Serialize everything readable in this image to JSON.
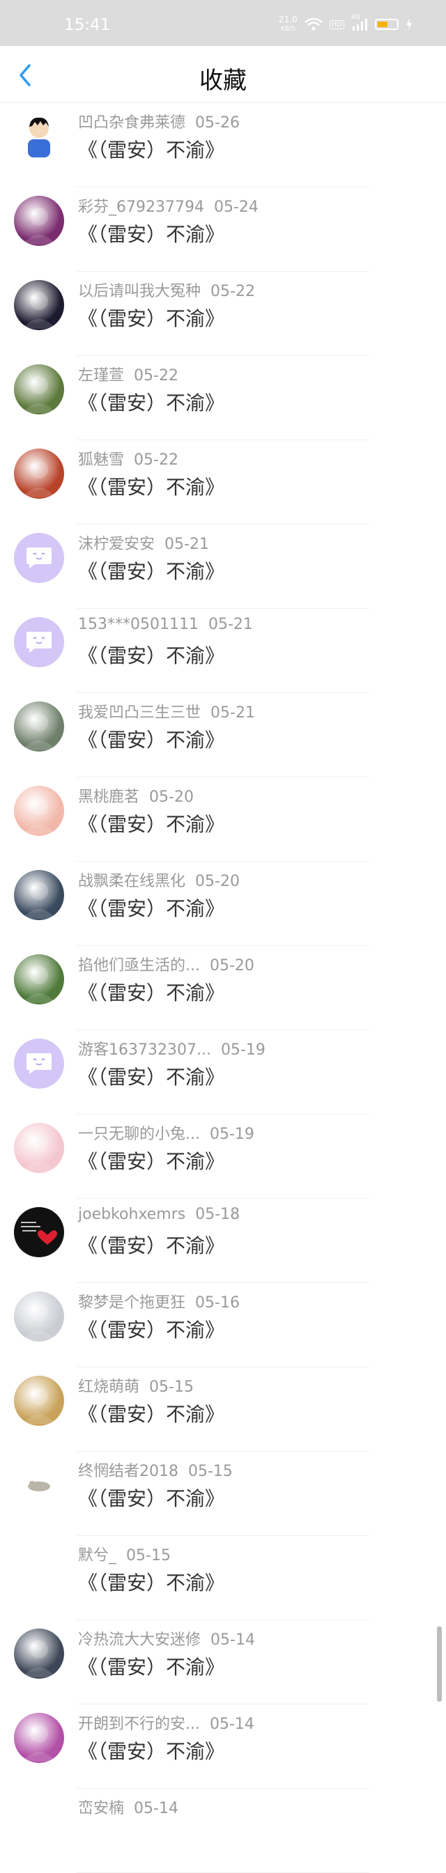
{
  "status_bar": {
    "time": "15:41",
    "net_speed_value": "21.0",
    "net_speed_unit": "KB/S",
    "hd_label": "HD",
    "network_label": "4G",
    "battery_level": 0.55,
    "battery_color": "#f5b300"
  },
  "header": {
    "title": "收藏"
  },
  "comments": [
    {
      "user": "凹凸杂食弗莱德",
      "date": "05-26",
      "text": "《（雷安）不渝》",
      "avatar": "cartoon-boy",
      "color": "#3a6fd8"
    },
    {
      "user": "彩芬_679237794",
      "date": "05-24",
      "text": "《（雷安）不渝》",
      "avatar": "photo",
      "color": "#7a2c6e"
    },
    {
      "user": "以后请叫我大冤种",
      "date": "05-22",
      "text": "《（雷安）不渝》",
      "avatar": "anime",
      "color": "#1c1a2e"
    },
    {
      "user": "左瑾萱",
      "date": "05-22",
      "text": "《（雷安）不渝》",
      "avatar": "photo",
      "color": "#5d7a3c"
    },
    {
      "user": "狐魅雪",
      "date": "05-22",
      "text": "《（雷安）不渝》",
      "avatar": "anime",
      "color": "#b8432a"
    },
    {
      "user": "沫柠爱安安",
      "date": "05-21",
      "text": "《（雷安）不渝》",
      "avatar": "default",
      "color": "#d4c6f7"
    },
    {
      "user": "153***0501111",
      "date": "05-21",
      "text": "《（雷安）不渝》",
      "avatar": "default",
      "color": "#d4c6f7"
    },
    {
      "user": "我爱凹凸三生三世",
      "date": "05-21",
      "text": "《（雷安）不渝》",
      "avatar": "anime",
      "color": "#6e7f6a"
    },
    {
      "user": "黑桃鹿茗",
      "date": "05-20",
      "text": "《（雷安）不渝》",
      "avatar": "anime",
      "color": "#f2b7a9"
    },
    {
      "user": "战飘柔在线黑化",
      "date": "05-20",
      "text": "《（雷安）不渝》",
      "avatar": "anime",
      "color": "#3a4a5e"
    },
    {
      "user": "掐他们亟生活的...",
      "date": "05-20",
      "text": "《（雷安）不渝》",
      "avatar": "photo",
      "color": "#4f7a3a"
    },
    {
      "user": "游客163732307...",
      "date": "05-19",
      "text": "《（雷安）不渝》",
      "avatar": "default",
      "color": "#d4c6f7"
    },
    {
      "user": "一只无聊的小兔...",
      "date": "05-19",
      "text": "《（雷安）不渝》",
      "avatar": "anime",
      "color": "#f4c6cf"
    },
    {
      "user": "joebkohxemrs",
      "date": "05-18",
      "text": "《（雷安）不渝》",
      "avatar": "heart",
      "color": "#111111"
    },
    {
      "user": "黎梦是个拖更狂",
      "date": "05-16",
      "text": "《（雷安）不渝》",
      "avatar": "anime",
      "color": "#c9ccd3"
    },
    {
      "user": "红烧萌萌",
      "date": "05-15",
      "text": "《（雷安）不渝》",
      "avatar": "anime",
      "color": "#c9a25a"
    },
    {
      "user": "终惘结者2018",
      "date": "05-15",
      "text": "《（雷安）不渝》",
      "avatar": "small",
      "color": "#b9b5a8"
    },
    {
      "user": "默兮_",
      "date": "05-15",
      "text": "《（雷安）不渝》",
      "avatar": "none",
      "color": "#ffffff"
    },
    {
      "user": "冷热流大大安迷修",
      "date": "05-14",
      "text": "《（雷安）不渝》",
      "avatar": "anime",
      "color": "#3e4758"
    },
    {
      "user": "开朗到不行的安...",
      "date": "05-14",
      "text": "《（雷安）不渝》",
      "avatar": "anime",
      "color": "#b24fa6"
    },
    {
      "user": "峦安楠",
      "date": "05-14",
      "text": "",
      "avatar": "none",
      "color": "#ffffff"
    }
  ]
}
